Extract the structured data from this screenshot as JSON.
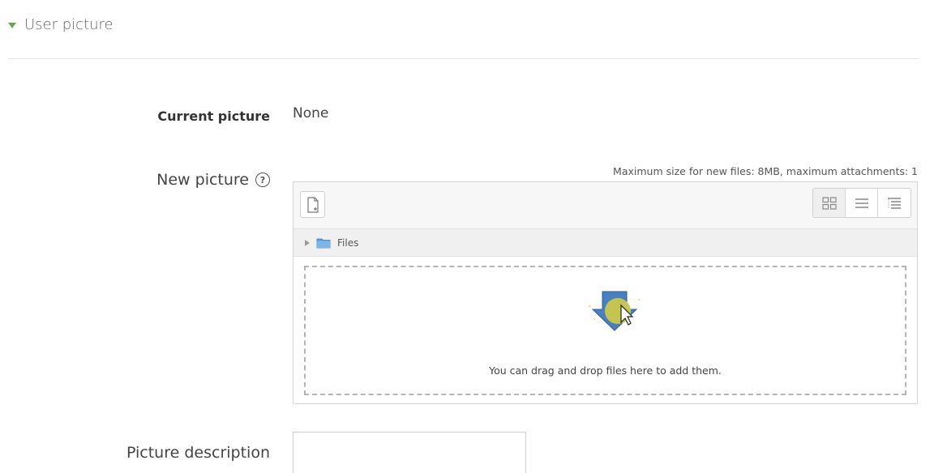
{
  "section": {
    "title": "User picture"
  },
  "current_picture": {
    "label": "Current picture",
    "value": "None"
  },
  "new_picture": {
    "label": "New picture",
    "help_symbol": "?",
    "max_size_text": "Maximum size for new files: 8MB, maximum attachments: 1",
    "path_label": "Files",
    "drop_text": "You can drag and drop files here to add them."
  },
  "picture_description": {
    "label": "Picture description",
    "value": ""
  },
  "colors": {
    "toggle_green": "#6aa84f",
    "arrow_blue": "#4a7fc1",
    "cursor_yellow": "#c9c94a"
  },
  "icons": {
    "toggle": "triangle-down-icon",
    "add_file": "add-file-icon",
    "view_icons": "grid-view-icon",
    "view_list": "list-view-icon",
    "view_tree": "tree-view-icon",
    "folder": "folder-icon",
    "drop": "download-arrow-icon"
  }
}
